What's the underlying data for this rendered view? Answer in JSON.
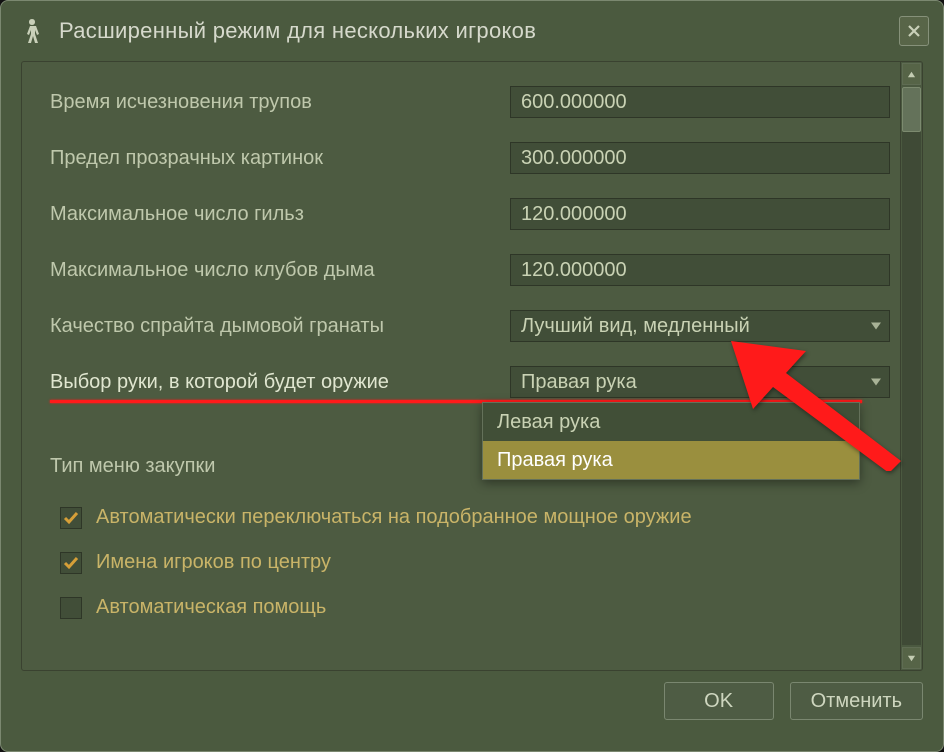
{
  "window": {
    "title": "Расширенный режим для нескольких игроков"
  },
  "rows": [
    {
      "label": "Время исчезновения трупов",
      "value": "600.000000",
      "type": "text"
    },
    {
      "label": "Предел прозрачных картинок",
      "value": "300.000000",
      "type": "text"
    },
    {
      "label": "Максимальное число гильз",
      "value": "120.000000",
      "type": "text"
    },
    {
      "label": "Максимальное число клубов дыма",
      "value": "120.000000",
      "type": "text"
    },
    {
      "label": "Качество спрайта дымовой гранаты",
      "value": "Лучший вид, медленный",
      "type": "select"
    },
    {
      "label": "Выбор руки, в которой будет оружие",
      "value": "Правая рука",
      "type": "select",
      "highlight": true
    }
  ],
  "dropdown": {
    "options": [
      "Левая рука",
      "Правая рука"
    ],
    "selected": "Правая рука"
  },
  "menu_label": "Тип меню закупки",
  "checkboxes": [
    {
      "label": "Автоматически переключаться на подобранное мощное оружие",
      "checked": true
    },
    {
      "label": "Имена игроков по центру",
      "checked": true
    },
    {
      "label": "Автоматическая помощь",
      "checked": false
    }
  ],
  "buttons": {
    "ok": "OK",
    "cancel": "Отменить"
  }
}
